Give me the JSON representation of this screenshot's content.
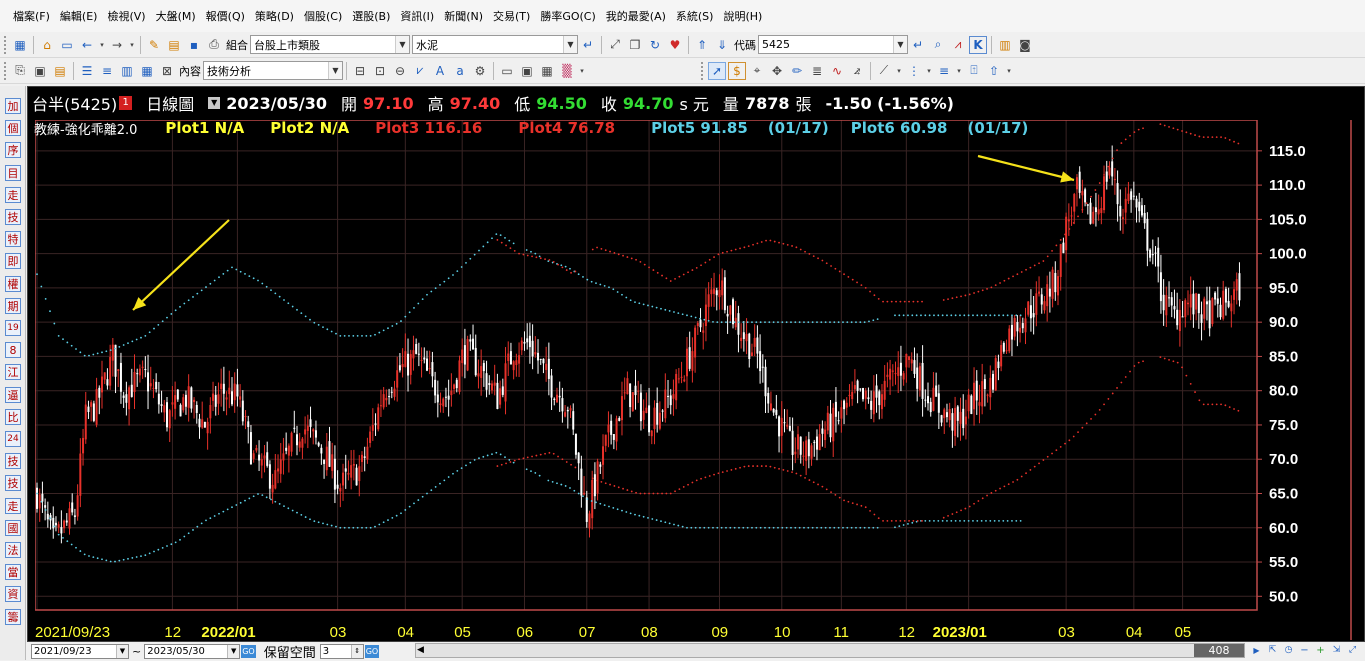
{
  "menu": [
    "檔案(F)",
    "編輯(E)",
    "檢視(V)",
    "大盤(M)",
    "報價(Q)",
    "策略(D)",
    "個股(C)",
    "選股(B)",
    "資訊(I)",
    "新聞(N)",
    "交易(T)",
    "勝率GO(C)",
    "我的最愛(A)",
    "系統(S)",
    "說明(H)"
  ],
  "toolbar1": {
    "group_label": "組合",
    "group_value": "台股上市類股",
    "sector_value": "水泥",
    "code_label": "代碼",
    "code_value": "5425"
  },
  "toolbar2": {
    "content_label": "內容",
    "content_value": "技術分析"
  },
  "sidebar_buttons": [
    "加",
    "個",
    "序",
    "目",
    "走",
    "技",
    "特",
    "即",
    "權",
    "期",
    "19",
    "8",
    "江",
    "逼",
    "比",
    "24",
    "技",
    "技",
    "走",
    "國",
    "法",
    "當",
    "資",
    "籌"
  ],
  "info": {
    "stock": "台半(5425)",
    "badge": "1",
    "period": "日線圖",
    "date": "2023/05/30",
    "open_label": "開",
    "open": "97.10",
    "high_label": "高",
    "high": "97.40",
    "low_label": "低",
    "low": "94.50",
    "close_label": "收",
    "close": "94.70",
    "unit": "s 元",
    "volume_label": "量",
    "volume": "7878",
    "volume_unit": "張",
    "change": "-1.50 (-1.56%)"
  },
  "indicator": {
    "name": "教練-強化乖離2.0",
    "plot1": "Plot1 N/A",
    "plot2": "Plot2 N/A",
    "plot3": "Plot3 116.16",
    "plot4": "Plot4 76.78",
    "plot5": "Plot5 91.85",
    "plot5_date": "(01/17)",
    "plot6": "Plot6 60.98",
    "plot6_date": "(01/17)"
  },
  "colors": {
    "up": "#e8312a",
    "down": "#ffffff",
    "red_band": "#e8312a",
    "cyan_band": "#5ccfe6",
    "yellow": "#ffff33",
    "green": "#33dd33",
    "grid": "#3a2424",
    "frame": "#c04a4a",
    "arrow": "#f5e21a"
  },
  "bottom": {
    "date_from": "2021/09/23",
    "tilde": "~",
    "date_to": "2023/05/30",
    "reserve_label": "保留空間",
    "reserve_value": "3",
    "bar_count": "408"
  },
  "chart_data": {
    "type": "candlestick",
    "y_ticks": [
      "115.0",
      "110.0",
      "105.0",
      "100.0",
      "95.0",
      "90.0",
      "85.0",
      "80.0",
      "75.0",
      "70.0",
      "65.0",
      "60.0",
      "55.0",
      "50.0"
    ],
    "ylim": [
      48,
      119.5
    ],
    "x_ticks": [
      {
        "label": "2021/09/23",
        "i": 0
      },
      {
        "label": "12",
        "i": 50
      },
      {
        "label": "2022/01",
        "i": 74
      },
      {
        "label": "03",
        "i": 111
      },
      {
        "label": "04",
        "i": 136
      },
      {
        "label": "05",
        "i": 157
      },
      {
        "label": "06",
        "i": 180
      },
      {
        "label": "07",
        "i": 203
      },
      {
        "label": "08",
        "i": 226
      },
      {
        "label": "09",
        "i": 252
      },
      {
        "label": "10",
        "i": 275
      },
      {
        "label": "11",
        "i": 297
      },
      {
        "label": "12",
        "i": 321
      },
      {
        "label": "2023/01",
        "i": 344
      },
      {
        "label": "03",
        "i": 380
      },
      {
        "label": "04",
        "i": 405
      },
      {
        "label": "05",
        "i": 423
      }
    ],
    "n_bars": 450,
    "close_anchors": [
      [
        0,
        65
      ],
      [
        6,
        58
      ],
      [
        14,
        62
      ],
      [
        18,
        76
      ],
      [
        22,
        78
      ],
      [
        28,
        85
      ],
      [
        32,
        80
      ],
      [
        40,
        82
      ],
      [
        48,
        76
      ],
      [
        55,
        79
      ],
      [
        62,
        75
      ],
      [
        68,
        80
      ],
      [
        74,
        79
      ],
      [
        80,
        70
      ],
      [
        88,
        67
      ],
      [
        98,
        75
      ],
      [
        106,
        71
      ],
      [
        112,
        66
      ],
      [
        120,
        69
      ],
      [
        128,
        80
      ],
      [
        134,
        83
      ],
      [
        140,
        85
      ],
      [
        146,
        81
      ],
      [
        152,
        79
      ],
      [
        158,
        86
      ],
      [
        164,
        83
      ],
      [
        170,
        79
      ],
      [
        176,
        86
      ],
      [
        182,
        87
      ],
      [
        188,
        82
      ],
      [
        196,
        78
      ],
      [
        203,
        62
      ],
      [
        210,
        72
      ],
      [
        218,
        80
      ],
      [
        226,
        76
      ],
      [
        234,
        79
      ],
      [
        242,
        86
      ],
      [
        248,
        93
      ],
      [
        252,
        96
      ],
      [
        258,
        90
      ],
      [
        266,
        85
      ],
      [
        272,
        77
      ],
      [
        278,
        72
      ],
      [
        284,
        71
      ],
      [
        290,
        74
      ],
      [
        296,
        76
      ],
      [
        302,
        79
      ],
      [
        308,
        78
      ],
      [
        316,
        82
      ],
      [
        322,
        85
      ],
      [
        328,
        80
      ],
      [
        334,
        77
      ],
      [
        340,
        75
      ],
      [
        346,
        79
      ],
      [
        352,
        81
      ],
      [
        358,
        88
      ],
      [
        364,
        91
      ],
      [
        370,
        93
      ],
      [
        376,
        96
      ],
      [
        380,
        104
      ],
      [
        384,
        109
      ],
      [
        388,
        105
      ],
      [
        392,
        107
      ],
      [
        396,
        113
      ],
      [
        400,
        106
      ],
      [
        404,
        109
      ],
      [
        408,
        104
      ],
      [
        412,
        100
      ],
      [
        416,
        93
      ],
      [
        420,
        91
      ],
      [
        424,
        93
      ],
      [
        428,
        92
      ],
      [
        432,
        91
      ],
      [
        436,
        92
      ],
      [
        440,
        93
      ],
      [
        444,
        95
      ]
    ],
    "plot3_red_upper": [
      [
        170,
        102
      ],
      [
        178,
        100
      ],
      [
        190,
        99
      ],
      [
        198,
        97
      ],
      [
        206,
        101
      ],
      [
        214,
        100
      ],
      [
        222,
        99
      ],
      [
        234,
        96
      ],
      [
        244,
        98
      ],
      [
        252,
        100
      ],
      [
        262,
        101
      ],
      [
        270,
        102
      ],
      [
        280,
        101
      ],
      [
        290,
        99
      ],
      [
        298,
        97
      ],
      [
        306,
        95
      ],
      [
        312,
        93
      ],
      [
        322,
        93
      ],
      [
        332,
        93
      ],
      [
        344,
        94
      ],
      [
        352,
        95
      ],
      [
        362,
        97
      ],
      [
        372,
        99
      ],
      [
        382,
        104
      ],
      [
        392,
        110
      ],
      [
        400,
        116
      ],
      [
        406,
        118
      ],
      [
        414,
        119
      ],
      [
        422,
        118
      ],
      [
        430,
        117
      ],
      [
        438,
        117
      ],
      [
        444,
        116
      ]
    ],
    "plot4_red_lower": [
      [
        170,
        69
      ],
      [
        178,
        70
      ],
      [
        190,
        71
      ],
      [
        198,
        69
      ],
      [
        206,
        67
      ],
      [
        214,
        66
      ],
      [
        222,
        65
      ],
      [
        234,
        65
      ],
      [
        244,
        67
      ],
      [
        252,
        68
      ],
      [
        262,
        69
      ],
      [
        270,
        69
      ],
      [
        280,
        68
      ],
      [
        290,
        66
      ],
      [
        298,
        64
      ],
      [
        306,
        63
      ],
      [
        312,
        61
      ],
      [
        322,
        61
      ],
      [
        332,
        61
      ],
      [
        344,
        63
      ],
      [
        352,
        65
      ],
      [
        362,
        67
      ],
      [
        372,
        70
      ],
      [
        382,
        73
      ],
      [
        392,
        77
      ],
      [
        400,
        81
      ],
      [
        406,
        84
      ],
      [
        414,
        85
      ],
      [
        422,
        84
      ],
      [
        430,
        78
      ],
      [
        438,
        78
      ],
      [
        444,
        77
      ]
    ],
    "plot5_cyan_upper": [
      [
        0,
        97
      ],
      [
        8,
        88
      ],
      [
        18,
        85
      ],
      [
        28,
        86
      ],
      [
        40,
        88
      ],
      [
        52,
        92
      ],
      [
        62,
        95
      ],
      [
        72,
        98
      ],
      [
        82,
        96
      ],
      [
        92,
        93
      ],
      [
        102,
        90
      ],
      [
        112,
        88
      ],
      [
        124,
        88
      ],
      [
        134,
        90
      ],
      [
        144,
        94
      ],
      [
        154,
        97
      ],
      [
        162,
        100
      ],
      [
        170,
        103
      ],
      [
        178,
        101
      ],
      [
        184,
        100
      ],
      [
        188,
        99
      ],
      [
        196,
        98
      ],
      [
        204,
        96
      ],
      [
        212,
        95
      ],
      [
        220,
        93
      ],
      [
        230,
        92
      ],
      [
        240,
        91
      ],
      [
        250,
        90
      ],
      [
        262,
        90
      ],
      [
        274,
        90
      ],
      [
        286,
        90
      ],
      [
        296,
        90
      ],
      [
        306,
        90
      ],
      [
        316,
        91
      ],
      [
        326,
        91
      ],
      [
        336,
        91
      ],
      [
        346,
        91
      ],
      [
        356,
        91
      ],
      [
        364,
        91
      ]
    ],
    "plot6_cyan_lower": [
      [
        0,
        65
      ],
      [
        8,
        59
      ],
      [
        18,
        56
      ],
      [
        28,
        55
      ],
      [
        40,
        56
      ],
      [
        52,
        58
      ],
      [
        62,
        61
      ],
      [
        72,
        63
      ],
      [
        82,
        65
      ],
      [
        92,
        63
      ],
      [
        102,
        61
      ],
      [
        112,
        60
      ],
      [
        124,
        60
      ],
      [
        134,
        62
      ],
      [
        144,
        65
      ],
      [
        154,
        68
      ],
      [
        162,
        70
      ],
      [
        170,
        71
      ],
      [
        178,
        69
      ],
      [
        184,
        68
      ],
      [
        188,
        67
      ],
      [
        196,
        66
      ],
      [
        204,
        64
      ],
      [
        212,
        63
      ],
      [
        220,
        62
      ],
      [
        230,
        61
      ],
      [
        240,
        60
      ],
      [
        250,
        60
      ],
      [
        262,
        60
      ],
      [
        274,
        60
      ],
      [
        286,
        60
      ],
      [
        296,
        60
      ],
      [
        306,
        60
      ],
      [
        316,
        60
      ],
      [
        326,
        61
      ],
      [
        336,
        61
      ],
      [
        346,
        61
      ],
      [
        356,
        61
      ],
      [
        364,
        61
      ]
    ]
  }
}
